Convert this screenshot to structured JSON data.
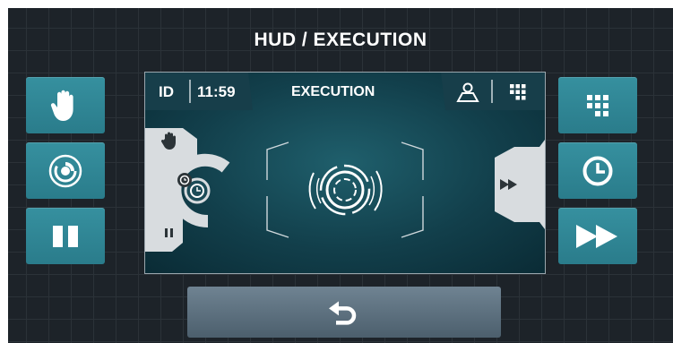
{
  "header": {
    "title": "HUD / EXECUTION"
  },
  "panel": {
    "id_label": "ID",
    "time": "11:59",
    "mode_label": "EXECUTION"
  },
  "left_buttons": [
    {
      "icon": "hand-icon"
    },
    {
      "icon": "ring-dial-icon"
    },
    {
      "icon": "pause-icon"
    }
  ],
  "right_buttons": [
    {
      "icon": "grid-icon"
    },
    {
      "icon": "clock-icon"
    },
    {
      "icon": "fast-forward-icon"
    }
  ],
  "footer": {
    "icon": "return-arrow-icon"
  },
  "colors": {
    "background": "#1d2329",
    "button_teal": "#2f8494",
    "back_button": "#5e7282",
    "panel": "#154754",
    "widget_grey": "#d8dcdf"
  }
}
